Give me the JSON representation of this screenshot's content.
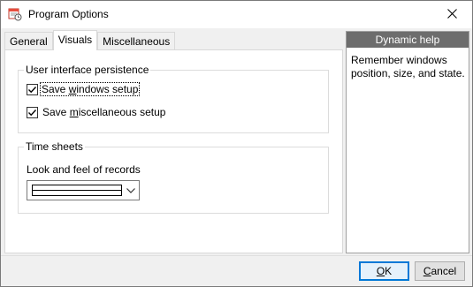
{
  "window": {
    "title": "Program Options",
    "icons": {
      "app": "calendar-clock-icon",
      "close": "close-icon"
    }
  },
  "tabs": [
    {
      "label": "General",
      "active": false
    },
    {
      "label": "Visuals",
      "active": true
    },
    {
      "label": "Miscellaneous",
      "active": false
    }
  ],
  "ui_persistence": {
    "title": "User interface persistence",
    "save_windows": {
      "prefix": "Save ",
      "accel": "w",
      "suffix": "indows setup",
      "checked": true
    },
    "save_misc": {
      "prefix": "Save ",
      "accel": "m",
      "suffix": "iscellaneous setup",
      "checked": true
    }
  },
  "time_sheets": {
    "title": "Time sheets",
    "look_label": "Look and feel of records",
    "selected_style": "solid-line"
  },
  "help": {
    "title": "Dynamic help",
    "text": "Remember windows position, size, and state."
  },
  "buttons": {
    "ok_accel": "O",
    "ok_rest": "K",
    "cancel_accel": "C",
    "cancel_rest": "ancel"
  },
  "colors": {
    "accent": "#0078d7",
    "help_header_bg": "#6d6d6d",
    "window_bg": "#f0f0f0"
  }
}
